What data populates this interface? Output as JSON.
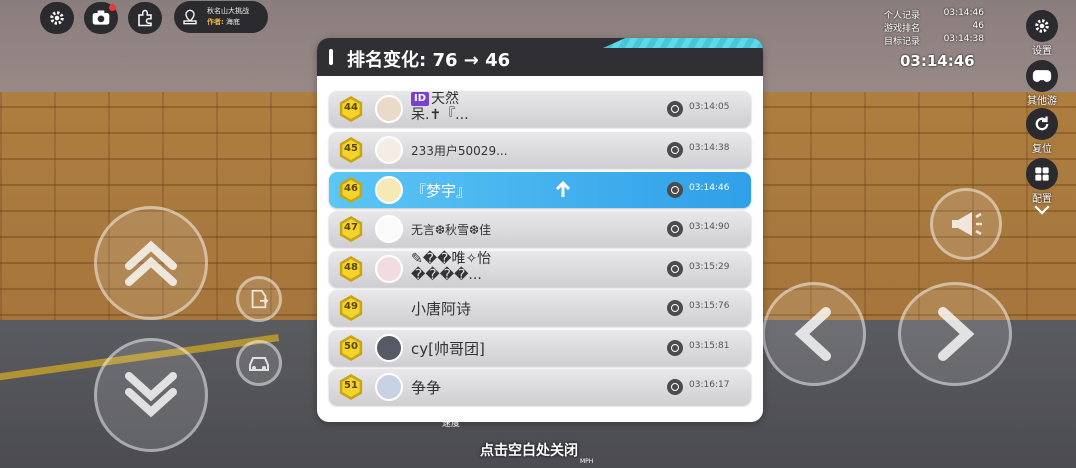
{
  "top_bar": {
    "map_name": "秋名山大挑战",
    "author_label": "作者:",
    "author_name": "海底"
  },
  "records": {
    "personal_label": "个人记录",
    "personal_value": "03:14:46",
    "rank_label": "游戏排名",
    "rank_value": "46",
    "target_label": "目标记录",
    "target_value": "03:14:38",
    "current_time": "03:14:46"
  },
  "right_menu": {
    "settings": "设置",
    "other_games": "其他游戏",
    "reset": "复位",
    "config": "配置"
  },
  "panel": {
    "title": "排名变化: 76 → 46",
    "rows": [
      {
        "rank": "44",
        "tag": "ID",
        "name_line1": "天然",
        "name_line2": "呆.✝『...",
        "time": "03:14:05"
      },
      {
        "rank": "45",
        "name": "233用户50029...",
        "time": "03:14:38"
      },
      {
        "rank": "46",
        "name": "『梦宇』",
        "time": "03:14:46"
      },
      {
        "rank": "47",
        "name": "无言❆秋雪❆佳",
        "time": "03:14:90"
      },
      {
        "rank": "48",
        "name_line1": "✎��唯✧怡",
        "name_line2": "����...",
        "time": "03:15:29"
      },
      {
        "rank": "49",
        "name": "小唐阿诗",
        "time": "03:15:76"
      },
      {
        "rank": "50",
        "name": "cy[帅哥团]",
        "time": "03:15:81"
      },
      {
        "rank": "51",
        "name": "争争",
        "time": "03:16:17"
      }
    ]
  },
  "footer": {
    "close_hint": "点击空白处关闭",
    "speed_label": "速度",
    "unit": "MPH"
  },
  "colors": {
    "highlight": "#2f9fe8",
    "medal": "#f4d32a",
    "header": "#303034"
  }
}
